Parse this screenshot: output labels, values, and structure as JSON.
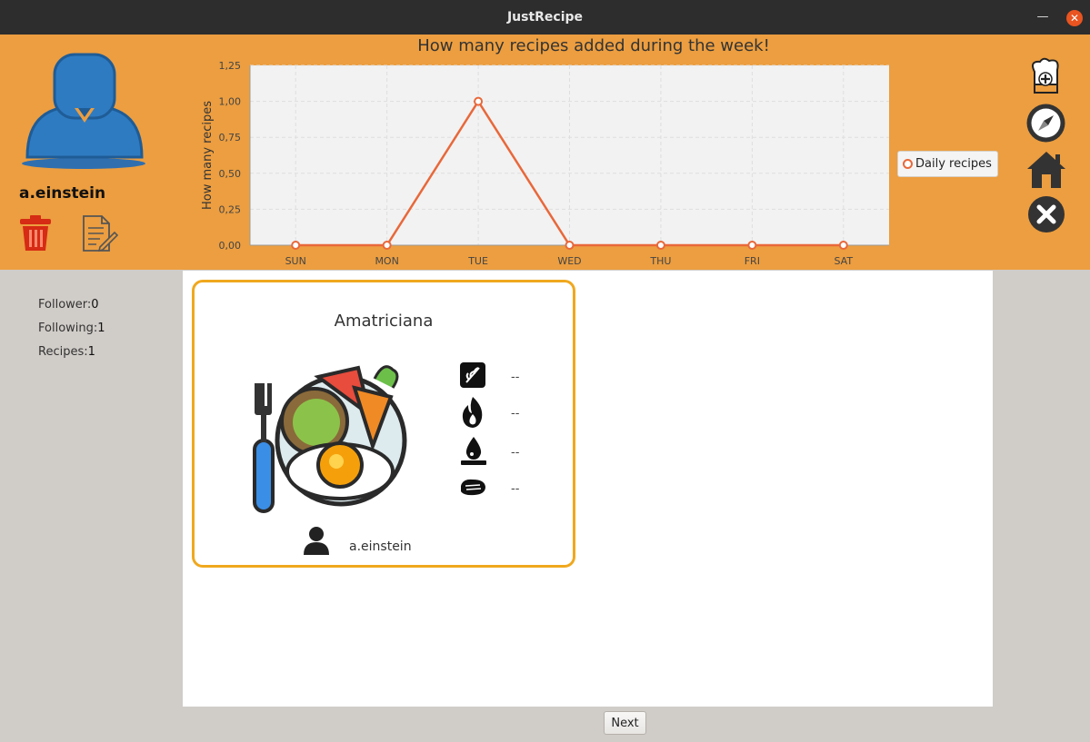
{
  "window": {
    "title": "JustRecipe"
  },
  "profile": {
    "username": "a.einstein"
  },
  "chart_data": {
    "type": "line",
    "title": "How many recipes added during the week!",
    "xlabel": "",
    "ylabel": "How many recipes",
    "categories": [
      "SUN",
      "MON",
      "TUE",
      "WED",
      "THU",
      "FRI",
      "SAT"
    ],
    "series": [
      {
        "name": "Daily recipes",
        "values": [
          0,
          0,
          1,
          0,
          0,
          0,
          0
        ]
      }
    ],
    "ylim": [
      0,
      1.25
    ],
    "yticks": [
      "0,00",
      "0,25",
      "0,50",
      "0,75",
      "1,00",
      "1,25"
    ],
    "grid": true,
    "legend": "right",
    "color": "#e8683a"
  },
  "stats": {
    "follower_label": "Follower:",
    "follower_value": "0",
    "following_label": "Following:",
    "following_value": "1",
    "recipes_label": "Recipes:",
    "recipes_value": "1"
  },
  "recipe_card": {
    "title": "Amatriciana",
    "nutrition": [
      "--",
      "--",
      "--",
      "--"
    ],
    "author": "a.einstein"
  },
  "pagination": {
    "next_label": "Next"
  },
  "colors": {
    "header": "#ec9e40",
    "card_border": "#f0a81e",
    "line": "#e8683a",
    "close": "#e95420"
  }
}
